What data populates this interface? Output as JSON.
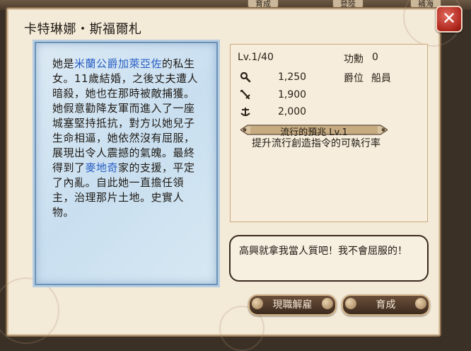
{
  "background": {
    "tabs": [
      "育成",
      "登陸",
      "補海"
    ]
  },
  "dialog": {
    "title": "卡特琳娜・斯福爾札",
    "close_label": "✕"
  },
  "bio": {
    "part1": "她是",
    "link1": "米蘭公爵加萊亞佐",
    "part2": "的私生女。11歲結婚，之後丈夫遭人暗殺，她也在那時被敵捕獲。她假意勸降友軍而進入了一座城塞堅持抵抗，對方以她兒子生命相逼，她依然沒有屈服，展現出令人震撼的氣魄。最終得到了",
    "link2": "麥地奇",
    "part3": "家的支援，平定了內亂。自此她一直擔任領主，治理那片土地。史實人物。"
  },
  "stats": {
    "level": "Lv.1/40",
    "merit_label": "功勳",
    "merit_value": "0",
    "rank_label": "爵位",
    "rank_value": "船員",
    "rows": [
      {
        "icon": "magnifier-icon",
        "value": "1,250"
      },
      {
        "icon": "sword-icon",
        "value": "1,900"
      },
      {
        "icon": "anchor-icon",
        "value": "2,000"
      }
    ],
    "skill_title": "流行的預兆 Lv.1",
    "skill_desc": "提升流行創造指令的可執行率"
  },
  "quote": "高興就拿我當人質吧！我不會屈服的！",
  "buttons": {
    "dismiss": "現職解雇",
    "train": "育成"
  },
  "colors": {
    "panel_bg": "#f4ead8",
    "bio_bg": "#c9dff0",
    "highlight_text": "#2a5fc4",
    "close_button": "#b0281e",
    "button_bg": "#4f3a2a"
  }
}
